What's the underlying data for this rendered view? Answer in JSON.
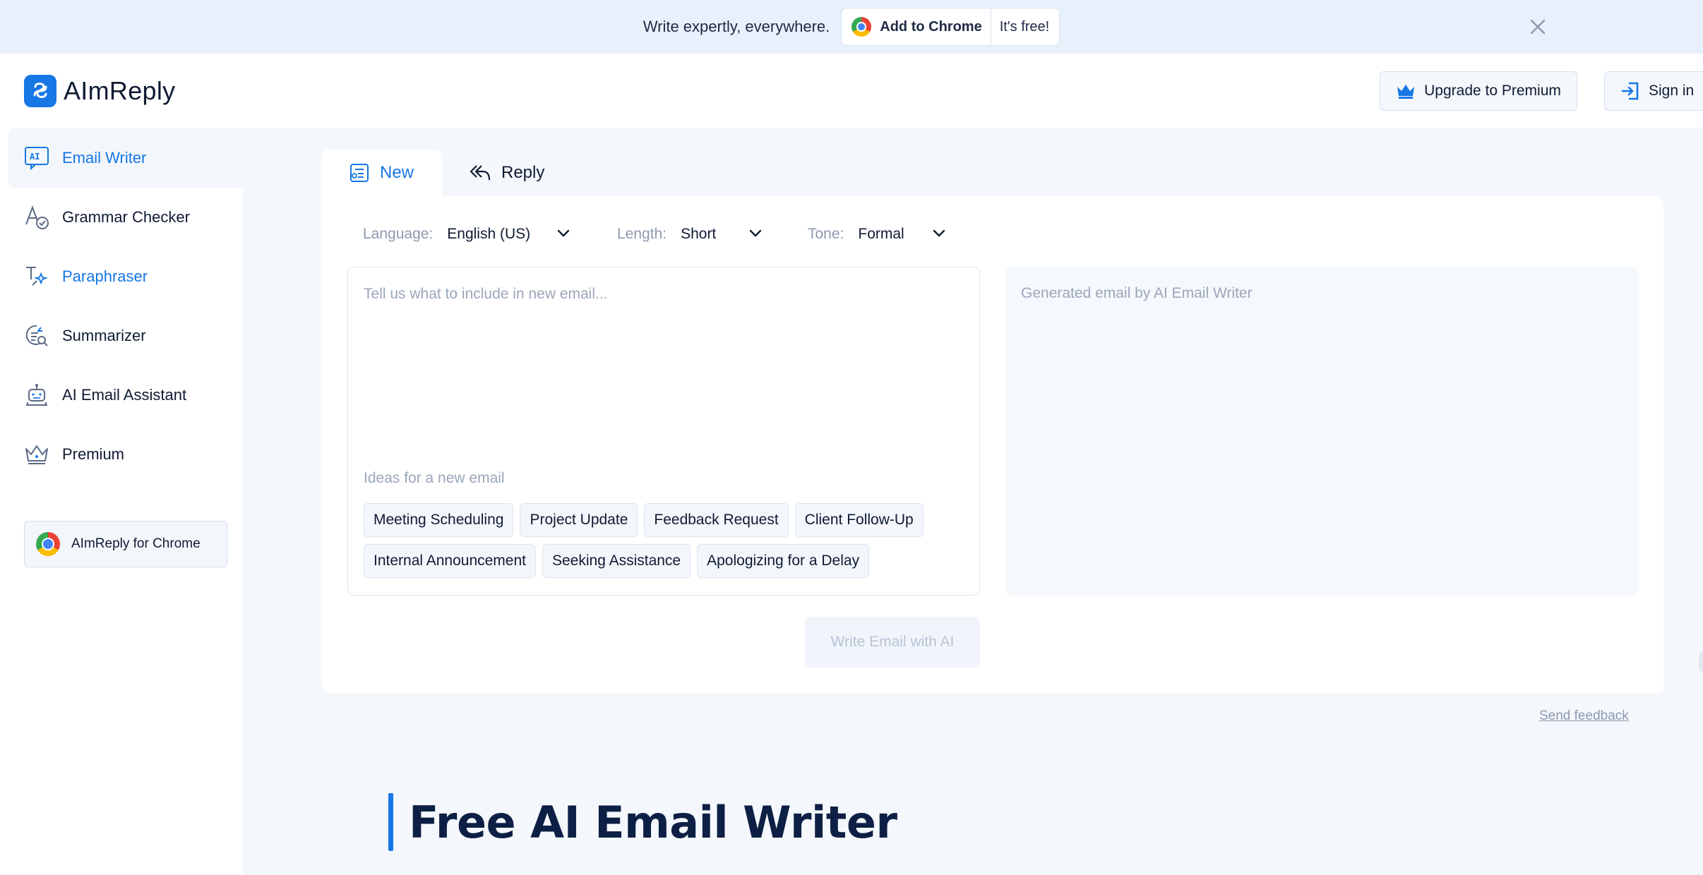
{
  "banner": {
    "text": "Write expertly, everywhere.",
    "add_label": "Add to Chrome",
    "free_label": "It's free!"
  },
  "header": {
    "brand": "AImReply",
    "upgrade_label": "Upgrade to Premium",
    "signin_label": "Sign in"
  },
  "sidebar": {
    "items": [
      {
        "label": "Email Writer",
        "icon": "ai-chat-icon"
      },
      {
        "label": "Grammar Checker",
        "icon": "grammar-check-icon"
      },
      {
        "label": "Paraphraser",
        "icon": "paraphrase-icon"
      },
      {
        "label": "Summarizer",
        "icon": "summarize-icon"
      },
      {
        "label": "AI Email Assistant",
        "icon": "robot-icon"
      },
      {
        "label": "Premium",
        "icon": "crown-icon"
      }
    ],
    "chrome_label": "AImReply for Chrome"
  },
  "tabs": [
    {
      "label": "New",
      "icon": "new-email-icon",
      "active": true
    },
    {
      "label": "Reply",
      "icon": "reply-icon",
      "active": false
    }
  ],
  "options": {
    "language": {
      "label": "Language:",
      "value": "English (US)"
    },
    "length": {
      "label": "Length:",
      "value": "Short"
    },
    "tone": {
      "label": "Tone:",
      "value": "Formal"
    }
  },
  "input": {
    "placeholder": "Tell us what to include in new email...",
    "ideas_label": "Ideas for a new email",
    "ideas": [
      "Meeting Scheduling",
      "Project Update",
      "Feedback Request",
      "Client Follow-Up",
      "Internal Announcement",
      "Seeking Assistance",
      "Apologizing for a Delay"
    ]
  },
  "output": {
    "placeholder": "Generated email by AI Email Writer"
  },
  "write_button": "Write Email with AI",
  "feedback_link": "Send feedback",
  "hero": {
    "title": "Free AI Email Writer"
  },
  "colors": {
    "accent": "#1677e5",
    "banner_bg": "#e8f0fc",
    "main_bg": "#f4f7fc"
  }
}
